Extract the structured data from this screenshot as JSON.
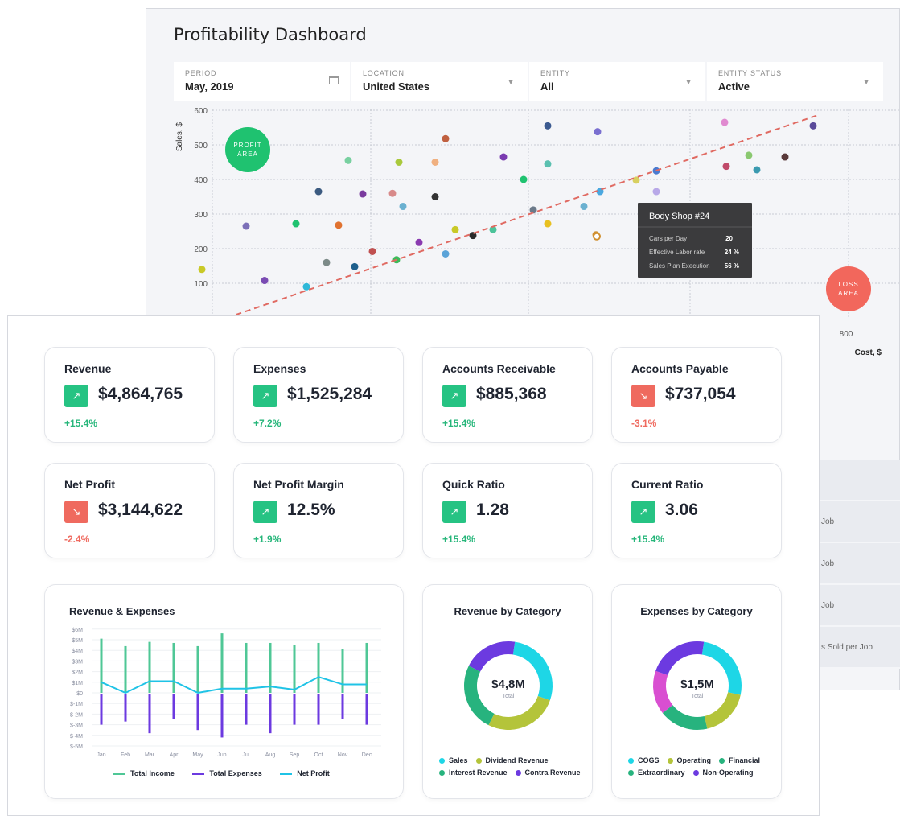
{
  "back": {
    "title": "Profitability Dashboard",
    "filters": [
      {
        "label": "PERIOD",
        "value": "May, 2019",
        "icon": "calendar-icon"
      },
      {
        "label": "LOCATION",
        "value": "United States",
        "icon": "chevron-down-icon"
      },
      {
        "label": "ENTITY",
        "value": "All",
        "icon": "chevron-down-icon"
      },
      {
        "label": "ENTITY STATUS",
        "value": "Active",
        "icon": "chevron-down-icon"
      }
    ],
    "scatter": {
      "ylabel": "Sales, $",
      "xlabel": "Cost, $",
      "y_ticks": [
        "600",
        "500",
        "400",
        "300",
        "200",
        "100"
      ],
      "x_tick_visible": "800",
      "profit_label": "PROFIT AREA",
      "loss_label": "LOSS AREA",
      "tooltip": {
        "title": "Body Shop #24",
        "rows": [
          {
            "label": "Cars per Day",
            "value": "20"
          },
          {
            "label": "Effective Labor rate",
            "value": "24 %"
          },
          {
            "label": "Sales Plan Execution",
            "value": "56 %"
          }
        ]
      }
    },
    "side_rows": [
      "",
      "Job",
      "Job",
      "Job",
      "s Sold per Job"
    ]
  },
  "kpis": [
    {
      "title": "Revenue",
      "value": "$4,864,765",
      "delta": "+15.4%",
      "trend": "up"
    },
    {
      "title": "Expenses",
      "value": "$1,525,284",
      "delta": "+7.2%",
      "trend": "up"
    },
    {
      "title": "Accounts Receivable",
      "value": "$885,368",
      "delta": "+15.4%",
      "trend": "up"
    },
    {
      "title": "Accounts Payable",
      "value": "$737,054",
      "delta": "-3.1%",
      "trend": "down"
    },
    {
      "title": "Net Profit",
      "value": "$3,144,622",
      "delta": "-2.4%",
      "trend": "down"
    },
    {
      "title": "Net Profit Margin",
      "value": "12.5%",
      "delta": "+1.9%",
      "trend": "up"
    },
    {
      "title": "Quick Ratio",
      "value": "1.28",
      "delta": "+15.4%",
      "trend": "up"
    },
    {
      "title": "Current Ratio",
      "value": "3.06",
      "delta": "+15.4%",
      "trend": "up"
    }
  ],
  "revexp": {
    "title": "Revenue & Expenses",
    "y_ticks": [
      "$6M",
      "$5M",
      "$4M",
      "$3M",
      "$2M",
      "$1M",
      "$0",
      "$-1M",
      "$-2M",
      "$-3M",
      "$-4M",
      "$-5M"
    ],
    "legend": [
      {
        "name": "Total Income",
        "color": "#4fc796"
      },
      {
        "name": "Total Expenses",
        "color": "#6c3ae0"
      },
      {
        "name": "Net Profit",
        "color": "#1fc3e6"
      }
    ]
  },
  "revcat": {
    "title": "Revenue by Category",
    "center_value": "$4,8M",
    "center_label": "Total",
    "legend": [
      {
        "name": "Sales",
        "color": "#1ed6e6"
      },
      {
        "name": "Dividend Revenue",
        "color": "#b4c43a"
      },
      {
        "name": "Interest Revenue",
        "color": "#27b37e"
      },
      {
        "name": "Contra Revenue",
        "color": "#6c3ae0"
      }
    ]
  },
  "expcat": {
    "title": "Expenses by Category",
    "center_value": "$1,5M",
    "center_label": "Total",
    "legend": [
      {
        "name": "COGS",
        "color": "#1ed6e6"
      },
      {
        "name": "Operating",
        "color": "#b4c43a"
      },
      {
        "name": "Financial",
        "color": "#27b37e"
      },
      {
        "name": "Extraordinary",
        "color": "#27b37e"
      },
      {
        "name": "Non-Operating",
        "color": "#6c3ae0"
      }
    ]
  },
  "chart_data": [
    {
      "type": "scatter",
      "title": "",
      "xlabel": "Cost, $",
      "ylabel": "Sales, $",
      "ylim": [
        0,
        600
      ],
      "points": [
        {
          "x": 250,
          "y": 140,
          "color": "#c9c927"
        },
        {
          "x": 305,
          "y": 265,
          "color": "#7b6fb8"
        },
        {
          "x": 328,
          "y": 108,
          "color": "#7a4bb3"
        },
        {
          "x": 367,
          "y": 272,
          "color": "#1fc270"
        },
        {
          "x": 380,
          "y": 90,
          "color": "#2fb8d8"
        },
        {
          "x": 395,
          "y": 365,
          "color": "#3b5a80"
        },
        {
          "x": 405,
          "y": 160,
          "color": "#7c8a88"
        },
        {
          "x": 420,
          "y": 268,
          "color": "#e07230"
        },
        {
          "x": 432,
          "y": 455,
          "color": "#78d0a0"
        },
        {
          "x": 440,
          "y": 148,
          "color": "#1e5f8c"
        },
        {
          "x": 450,
          "y": 358,
          "color": "#7a3b9e"
        },
        {
          "x": 462,
          "y": 192,
          "color": "#c05050"
        },
        {
          "x": 487,
          "y": 360,
          "color": "#d88a8a"
        },
        {
          "x": 492,
          "y": 168,
          "color": "#3dba5a"
        },
        {
          "x": 495,
          "y": 450,
          "color": "#a9c93c"
        },
        {
          "x": 500,
          "y": 322,
          "color": "#6ab0d0"
        },
        {
          "x": 520,
          "y": 218,
          "color": "#8a3bb0"
        },
        {
          "x": 540,
          "y": 350,
          "color": "#333333"
        },
        {
          "x": 540,
          "y": 450,
          "color": "#f0b080"
        },
        {
          "x": 553,
          "y": 518,
          "color": "#c06040"
        },
        {
          "x": 553,
          "y": 185,
          "color": "#5aa3d8"
        },
        {
          "x": 565,
          "y": 255,
          "color": "#c9c927"
        },
        {
          "x": 587,
          "y": 238,
          "color": "#2a2a2a"
        },
        {
          "x": 612,
          "y": 255,
          "color": "#4cc39a"
        },
        {
          "x": 625,
          "y": 465,
          "color": "#7a3bb0"
        },
        {
          "x": 650,
          "y": 400,
          "color": "#1fc270"
        },
        {
          "x": 662,
          "y": 312,
          "color": "#6b7a8a"
        },
        {
          "x": 680,
          "y": 555,
          "color": "#3b5a90"
        },
        {
          "x": 680,
          "y": 445,
          "color": "#5ac0b0"
        },
        {
          "x": 680,
          "y": 272,
          "color": "#e8c020"
        },
        {
          "x": 725,
          "y": 322,
          "color": "#6ab0d0"
        },
        {
          "x": 740,
          "y": 240,
          "color": "#d09030"
        },
        {
          "x": 742,
          "y": 538,
          "color": "#7a6fd0"
        },
        {
          "x": 745,
          "y": 365,
          "color": "#4aa8e0"
        },
        {
          "x": 790,
          "y": 398,
          "color": "#d8d060"
        },
        {
          "x": 815,
          "y": 425,
          "color": "#4a7ad0"
        },
        {
          "x": 815,
          "y": 365,
          "color": "#b8a8e8"
        },
        {
          "x": 840,
          "y": 300,
          "color": "#9aa8c0"
        },
        {
          "x": 900,
          "y": 565,
          "color": "#e08ad0"
        },
        {
          "x": 902,
          "y": 438,
          "color": "#c04a6a"
        },
        {
          "x": 930,
          "y": 470,
          "color": "#8ac870"
        },
        {
          "x": 940,
          "y": 428,
          "color": "#3a9ab0"
        },
        {
          "x": 975,
          "y": 465,
          "color": "#5a3a3a"
        },
        {
          "x": 1010,
          "y": 555,
          "color": "#5a4a9a"
        }
      ],
      "highlight": {
        "x": 735,
        "y": 240,
        "label": "Body Shop #24"
      }
    },
    {
      "type": "bar",
      "title": "Revenue & Expenses",
      "categories": [
        "Jan",
        "Feb",
        "Mar",
        "Apr",
        "May",
        "Jun",
        "Jul",
        "Aug",
        "Sep",
        "Oct",
        "Nov",
        "Dec"
      ],
      "ylim": [
        -5,
        6
      ],
      "series": [
        {
          "name": "Total Income",
          "values": [
            5.1,
            4.4,
            4.8,
            4.7,
            4.4,
            5.6,
            4.7,
            4.7,
            4.5,
            4.7,
            4.1,
            4.7
          ]
        },
        {
          "name": "Total Expenses",
          "values": [
            -3.0,
            -2.7,
            -3.8,
            -2.5,
            -3.5,
            -4.2,
            -3.0,
            -3.8,
            -3.0,
            -3.0,
            -2.5,
            -3.0
          ]
        },
        {
          "name": "Net Profit",
          "values": [
            1.0,
            0.0,
            1.1,
            1.1,
            0.0,
            0.4,
            0.4,
            0.6,
            0.3,
            1.5,
            0.8,
            0.8
          ]
        }
      ]
    },
    {
      "type": "pie",
      "title": "Revenue by Category",
      "categories": [
        "Sales",
        "Dividend Revenue",
        "Interest Revenue",
        "Contra Revenue"
      ],
      "values": [
        28,
        27,
        25,
        20
      ]
    },
    {
      "type": "pie",
      "title": "Expenses by Category",
      "categories": [
        "COGS",
        "Operating",
        "Extraordinary",
        "Financial",
        "Non-Operating"
      ],
      "values": [
        26,
        18,
        18,
        16,
        22
      ]
    }
  ]
}
